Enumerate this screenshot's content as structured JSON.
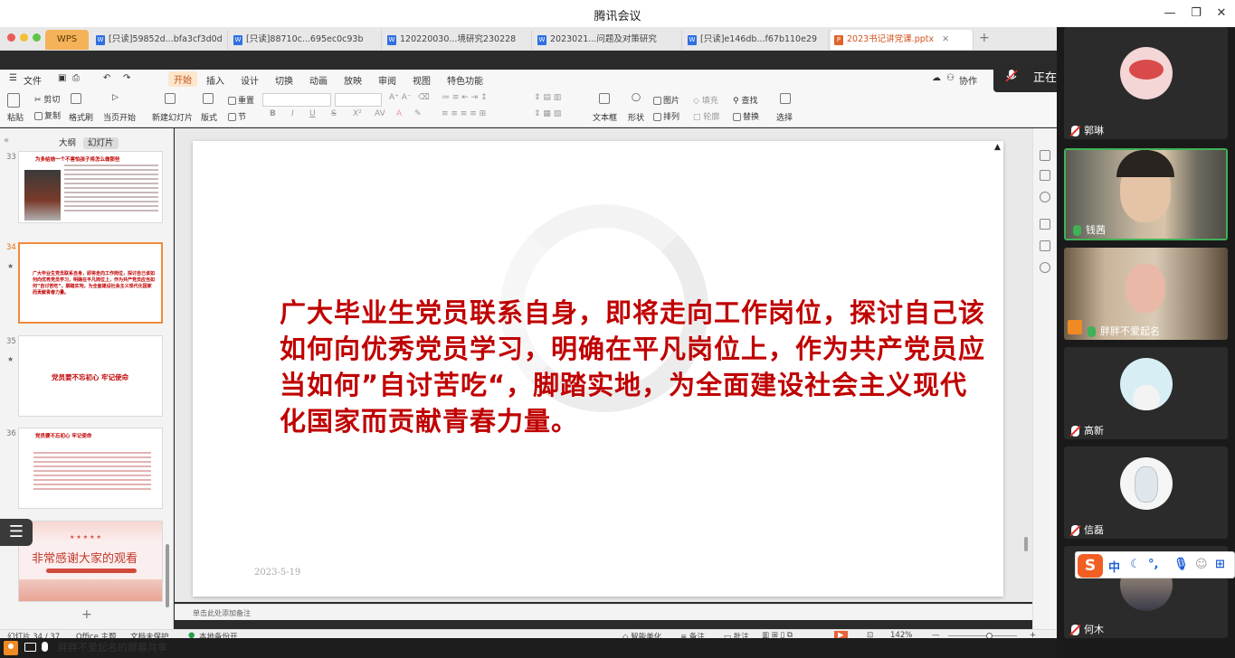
{
  "meeting": {
    "title": "腾讯会议",
    "speaking_banner": "正在讲话：钱茜;",
    "share_label": "胖胖不爱起名的屏幕共享"
  },
  "wps": {
    "home_tab": "WPS",
    "tabs": [
      {
        "label": "[只读]59852d...bfa3cf3d0d"
      },
      {
        "label": "[只读]88710c...695ec0c93b"
      },
      {
        "label": "120220030...境研究230228"
      },
      {
        "label": "2023021...问题及对策研究"
      },
      {
        "label": "[只读]e146db...f67b110e29"
      },
      {
        "label": "2023书记讲党课.pptx"
      }
    ],
    "menu": {
      "file": "文件",
      "items": [
        "开始",
        "插入",
        "设计",
        "切换",
        "动画",
        "放映",
        "审阅",
        "视图",
        "特色功能"
      ],
      "collab": "协作"
    },
    "ribbon": {
      "paste": "粘贴",
      "cut": "剪切",
      "copy": "复制",
      "format_painter": "格式刷",
      "from_current": "当页开始",
      "new_slide": "新建幻灯片",
      "layout": "版式",
      "section": "节",
      "reset": "重置",
      "text_box": "文本框",
      "shape": "形状",
      "arrange": "排列",
      "picture": "图片",
      "fill": "填充",
      "outline": "轮廓",
      "find": "查找",
      "replace": "替换",
      "select": "选择"
    },
    "panel": {
      "outline": "大纲",
      "slides": "幻灯片"
    },
    "thumbs": [
      {
        "num": "33",
        "title": "为多给她一个不害怕孩子将怎么做那些"
      },
      {
        "num": "34",
        "body": "广大毕业生党员联系自身，即将走向工作岗位，探讨自己该如何向优秀党员学习，明确在平凡岗位上，作为共产党员应当如何”自讨苦吃“，脚踏实地，为全面建设社会主义现代化国家而贡献青春力量。"
      },
      {
        "num": "35",
        "title": "党员要不忘初心 牢记使命"
      },
      {
        "num": "36",
        "title": "党员要不忘初心 牢记使命"
      },
      {
        "num": "37",
        "title": "非常感谢大家的观看"
      }
    ],
    "slide": {
      "text": "广大毕业生党员联系自身，即将走向工作岗位，探讨自己该如何向优秀党员学习，明确在平凡岗位上，作为共产党员应当如何”自讨苦吃“，脚踏实地，为全面建设社会主义现代化国家而贡献青春力量。",
      "date": "2023-5-19"
    },
    "notes_placeholder": "单击此处添加备注",
    "status": {
      "slide_pos": "幻灯片 34 / 37",
      "theme": "Office 主题",
      "doc_protect": "文档未保护",
      "backup": "本地备份开",
      "beautify": "智能美化",
      "notes": "备注",
      "comments": "批注",
      "zoom": "142%"
    }
  },
  "participants": [
    {
      "name": "郭琳",
      "mic": "muted"
    },
    {
      "name": "钱茜",
      "mic": "live"
    },
    {
      "name": "胖胖不爱起名",
      "mic": "live"
    },
    {
      "name": "高新",
      "mic": "muted"
    },
    {
      "name": "信磊",
      "mic": "muted"
    },
    {
      "name": "何木",
      "mic": "muted"
    }
  ],
  "ime": {
    "mode": "中"
  },
  "colors": {
    "slide_text": "#c00000",
    "active_border": "#3fb157",
    "accent_orange": "#e36c09"
  }
}
